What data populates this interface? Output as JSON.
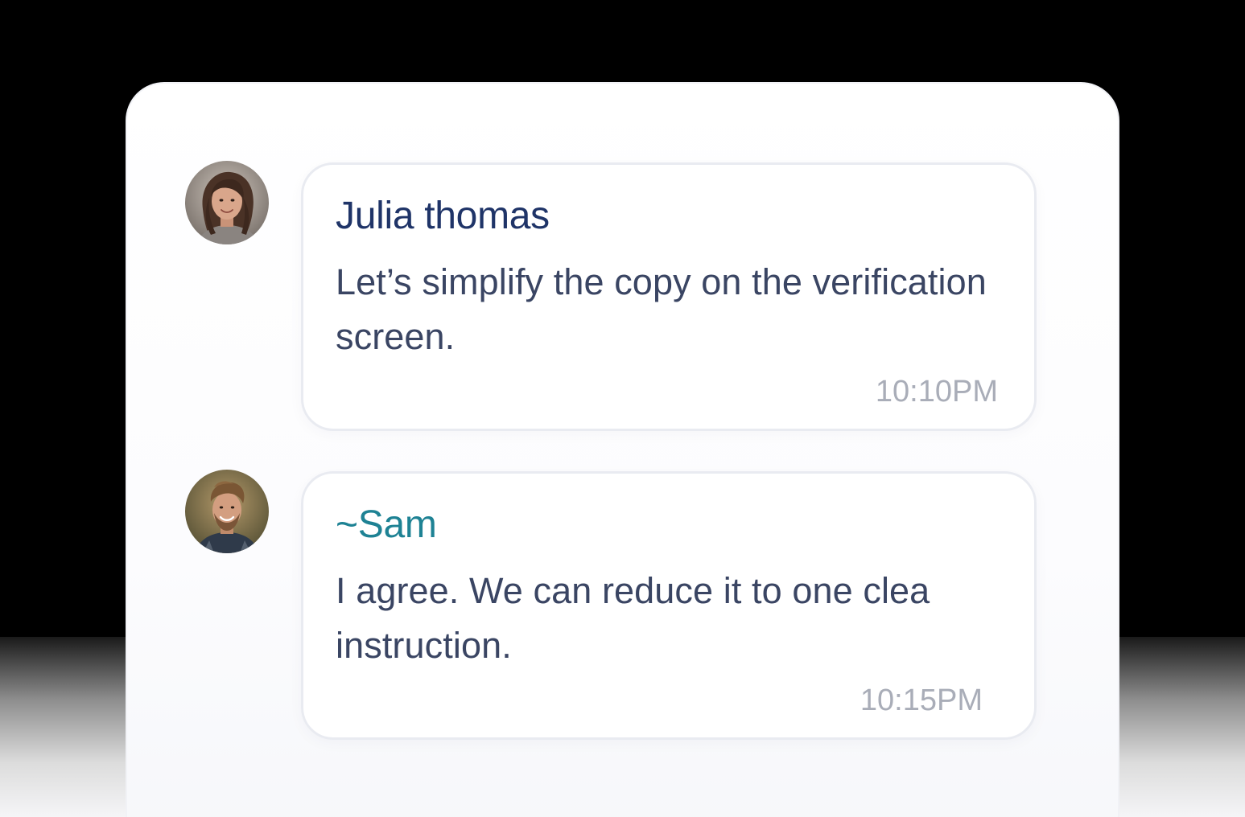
{
  "messages": [
    {
      "sender": "Julia thomas",
      "text": "Let’s simplify the copy on the verification screen.",
      "time": "10:10PM"
    },
    {
      "sender": "~Sam",
      "text": "I agree. We can reduce it to one clea instruction.",
      "time": "10:15PM"
    }
  ],
  "colors": {
    "julia_name": "#1f3468",
    "sam_name": "#1e8294",
    "message_text": "#3a4563",
    "timestamp": "#a9adb8",
    "bubble_border": "#e9ebf1",
    "panel_bg": "#ffffff",
    "page_bg": "#000000"
  }
}
